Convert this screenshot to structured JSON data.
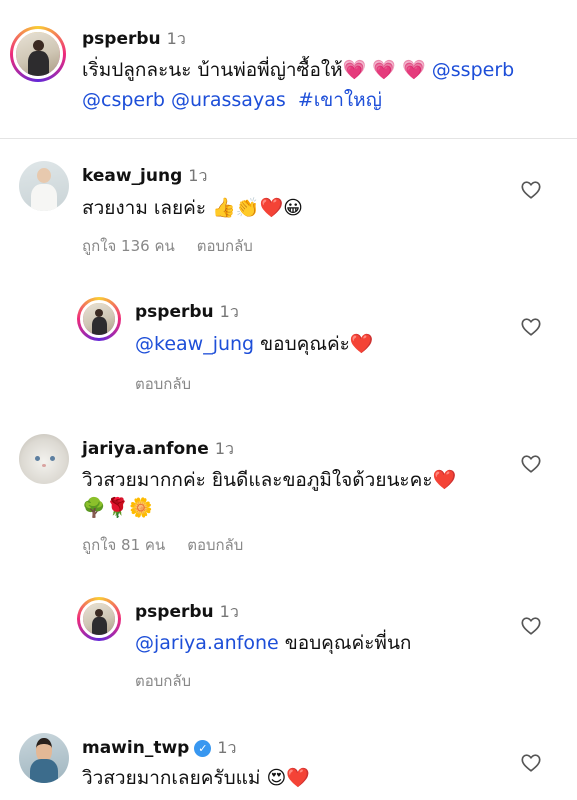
{
  "caption": {
    "username": "psperbu",
    "time": "1ว",
    "text": "เริ่มปลูกละนะ บ้านพ่อพี่ญ่าซื้อให้💗 💗 💗",
    "mentions_line1": "@ssperb",
    "mentions_line2": "@csperb @urassayas",
    "hashtag": "#เขาใหญ่"
  },
  "comments": [
    {
      "username": "keaw_jung",
      "time": "1ว",
      "text": "สวยงาม เลยค่ะ 👍👏❤️😀",
      "likes": "ถูกใจ 136 คน",
      "reply": "ตอบกลับ"
    },
    {
      "username": "psperbu",
      "time": "1ว",
      "mention": "@keaw_jung",
      "text": " ขอบคุณค่ะ❤️",
      "reply": "ตอบกลับ"
    },
    {
      "username": "jariya.anfone",
      "time": "1ว",
      "text": "วิวสวยมากกค่ะ  ยินดีและขอภูมิใจด้วยนะคะ❤️",
      "text2": "🌳🌹🌼",
      "likes": "ถูกใจ 81 คน",
      "reply": "ตอบกลับ"
    },
    {
      "username": "psperbu",
      "time": "1ว",
      "mention": "@jariya.anfone",
      "text": " ขอบคุณค่ะพี่นก",
      "reply": "ตอบกลับ"
    },
    {
      "username": "mawin_twp",
      "time": "1ว",
      "text": "วิวสวยมากเลยครับแม่ 😍❤️"
    }
  ],
  "icons": {
    "like": "heart-outline-icon",
    "verified": "verified-badge-icon"
  },
  "colors": {
    "mention": "#1d4ed8",
    "verified": "#3897f0",
    "secondary_text": "#888888"
  }
}
